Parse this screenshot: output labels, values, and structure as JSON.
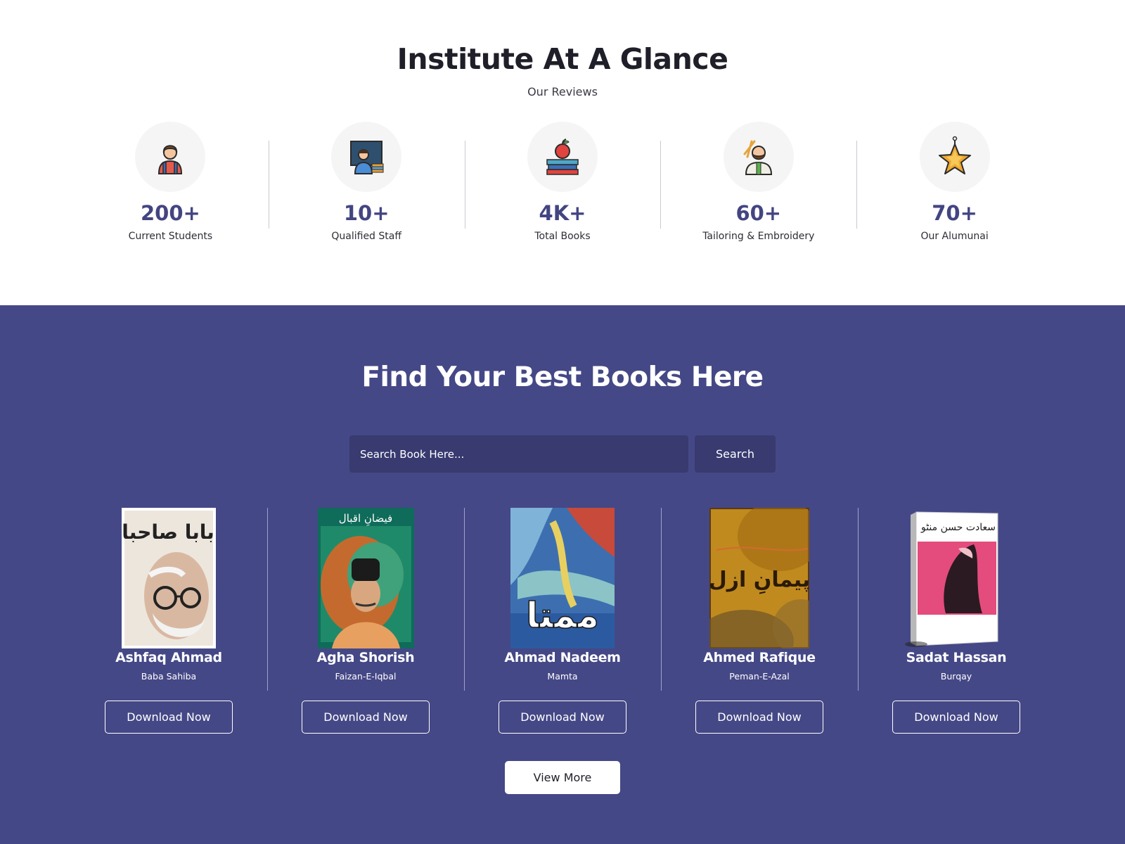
{
  "glance": {
    "title": "Institute At A Glance",
    "subtitle": "Our Reviews",
    "stats": [
      {
        "value": "200+",
        "label": "Current Students",
        "icon": "student-icon"
      },
      {
        "value": "10+",
        "label": "Qualified Staff",
        "icon": "teacher-icon"
      },
      {
        "value": "4K+",
        "label": "Total Books",
        "icon": "books-apple-icon"
      },
      {
        "value": "60+",
        "label": "Tailoring & Embroidery",
        "icon": "tailor-icon"
      },
      {
        "value": "70+",
        "label": "Our Alumunai",
        "icon": "star-medal-icon"
      }
    ]
  },
  "books": {
    "title": "Find Your Best Books Here",
    "search": {
      "placeholder": "Search Book Here...",
      "button_label": "Search"
    },
    "items": [
      {
        "author": "Ashfaq Ahmad",
        "title": "Baba Sahiba",
        "cover_text": "بابا صاحبا",
        "button_label": "Download Now"
      },
      {
        "author": "Agha Shorish",
        "title": "Faizan-E-Iqbal",
        "cover_text": "فیضانِ اقبال",
        "button_label": "Download Now"
      },
      {
        "author": "Ahmad Nadeem",
        "title": "Mamta",
        "cover_text": "ممتا",
        "button_label": "Download Now"
      },
      {
        "author": "Ahmed Rafique",
        "title": "Peman-E-Azal",
        "cover_text": "پیمانِ ازل",
        "button_label": "Download Now"
      },
      {
        "author": "Sadat Hassan",
        "title": "Burqay",
        "cover_text": "سعادت حسن منٹو",
        "button_label": "Download Now"
      }
    ],
    "view_more_label": "View More"
  },
  "colors": {
    "accent": "#454886",
    "stat_value": "#434582",
    "input_bg": "#383a70"
  }
}
